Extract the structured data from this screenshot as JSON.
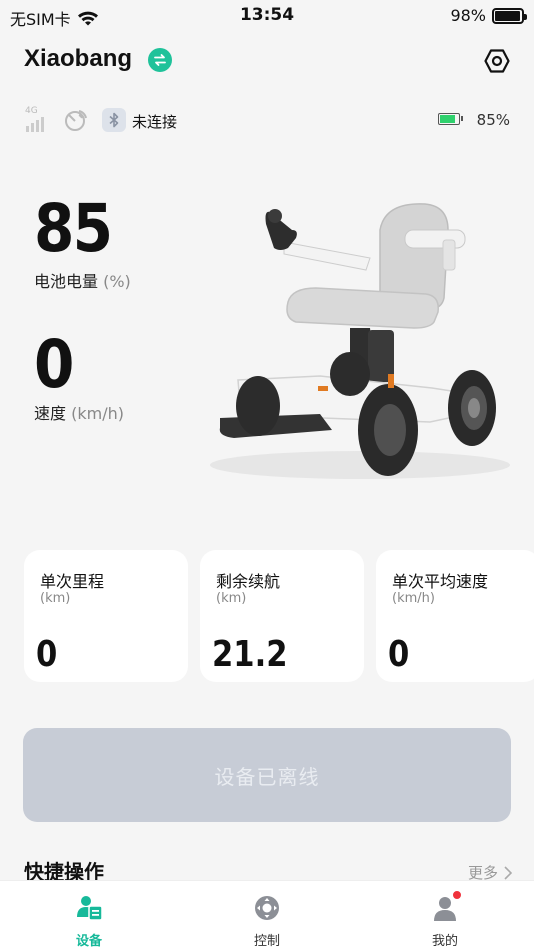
{
  "status_bar": {
    "carrier": "无SIM卡",
    "time": "13:54",
    "battery_percent": "98%",
    "battery_level": 0.98
  },
  "header": {
    "device_name": "Xiaobang",
    "icons": {
      "switch": "swap-arrows-icon",
      "settings": "hexagon-settings-icon"
    }
  },
  "connection": {
    "bluetooth_status": "未连接",
    "network_badge": "4G",
    "battery_percent": "85%",
    "battery_level": 0.85
  },
  "metrics": {
    "battery": {
      "value": "85",
      "label": "电池电量",
      "unit": "(%)"
    },
    "speed": {
      "value": "0",
      "label": "速度",
      "unit": "(km/h)"
    }
  },
  "stats": [
    {
      "title": "单次里程",
      "unit": "(km)",
      "value": "0"
    },
    {
      "title": "剩余续航",
      "unit": "(km)",
      "value": "21.2"
    },
    {
      "title": "单次平均速度",
      "unit": "(km/h)",
      "value": "0"
    }
  ],
  "offline_button": "设备已离线",
  "quick_actions": {
    "title": "快捷操作",
    "more": "更多"
  },
  "tabs": [
    {
      "label": "设备",
      "icon": "device-icon",
      "active": true
    },
    {
      "label": "控制",
      "icon": "control-icon",
      "active": false
    },
    {
      "label": "我的",
      "icon": "profile-icon",
      "active": false
    }
  ],
  "colors": {
    "accent": "#1fc29a",
    "offline_button": "#c7ccd6",
    "notification": "#f0323c"
  }
}
